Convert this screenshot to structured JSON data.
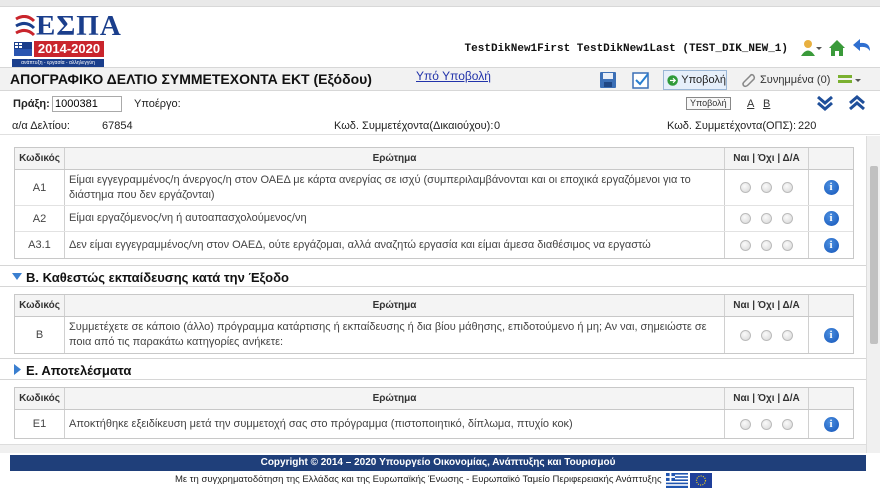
{
  "header": {
    "logo_text": "ΕΣΠΑ",
    "logo_years": "2014-2020",
    "logo_tagline": "ανάπτυξη - εργασία - αλληλεγγύη",
    "user": "TestDikNew1First TestDikNew1Last (TEST_DIK_NEW_1)",
    "icons": [
      "user-icon",
      "home-icon",
      "logout-icon"
    ]
  },
  "toolbar": {
    "title": "ΑΠΟΓΡΑΦΙΚΟ ΔΕΛΤΙΟ ΣΥΜΜΕΤΕΧΟΝΤΑ ΕΚΤ (Εξόδου)",
    "status_link": "Υπό Υποβολή",
    "submit_label": "Υποβολή",
    "attachments_label": "Συνημμένα (0)"
  },
  "filter": {
    "praxi_label": "Πράξη:",
    "praxi_value": "1000381",
    "ypoergo_label": "Υποέργο:",
    "tooltip": "Υποβολή",
    "link_a": "Α",
    "link_b": "Β"
  },
  "info": {
    "aa_label": "α/α Δελτίου:",
    "aa_value": "67854",
    "kod_dik_label": "Κωδ. Συμμετέχοντα(Δικαιούχου):",
    "kod_dik_value": "0",
    "kod_ops_label": "Κωδ. Συμμετέχοντα(ΟΠΣ):",
    "kod_ops_value": "220"
  },
  "table_headers": {
    "code": "Κωδικός",
    "question": "Ερώτημα",
    "answer": "Ναι | Όχι | Δ/Α"
  },
  "group_a": {
    "rows": [
      {
        "code": "Α1",
        "question": "Είμαι εγγεγραμμένος/η άνεργος/η στον ΟΑΕΔ με κάρτα ανεργίας σε ισχύ (συμπεριλαμβάνονται και οι εποχικά εργαζόμενοι για το διάστημα που δεν εργάζονται)"
      },
      {
        "code": "Α2",
        "question": "Είμαι εργαζόμενος/νη ή αυτοαπασχολούμενος/νη"
      },
      {
        "code": "Α3.1",
        "question": "Δεν είμαι εγγεγραμμένος/νη στον ΟΑΕΔ, ούτε εργάζομαι, αλλά αναζητώ εργασία και είμαι άμεσα διαθέσιμος να εργαστώ"
      }
    ]
  },
  "section_b": {
    "title": "Β. Καθεστώς εκπαίδευσης κατά την Έξοδο",
    "rows": [
      {
        "code": "Β",
        "question": "Συμμετέχετε σε κάποιο (άλλο) πρόγραμμα κατάρτισης ή εκπαίδευσης ή δια βίου μάθησης, επιδοτούμενο ή μη; Αν ναι, σημειώστε σε ποια από τις παρακάτω κατηγορίες ανήκετε:"
      }
    ]
  },
  "section_e": {
    "title": "Ε. Αποτελέσματα",
    "rows": [
      {
        "code": "Ε1",
        "question": "Αποκτήθηκε εξειδίκευση μετά την συμμετοχή σας στο πρόγραμμα (πιστοποιητικό, δίπλωμα, πτυχίο κοκ)"
      }
    ]
  },
  "footer": {
    "copyright": "Copyright © 2014 – 2020 Υπουργείο Οικονομίας, Ανάπτυξης και Τουρισμού",
    "funding": "Με τη συγχρηματοδότηση της Ελλάδας και της Ευρωπαϊκής Ένωσης - Ευρωπαϊκό Ταμείο Περιφερειακής Ανάπτυξης"
  },
  "colors": {
    "brand_blue": "#1a3e8c",
    "brand_red": "#c9252c",
    "footer_blue": "#1f3f7a",
    "info_blue": "#1454b8",
    "link_blue": "#2233aa"
  }
}
